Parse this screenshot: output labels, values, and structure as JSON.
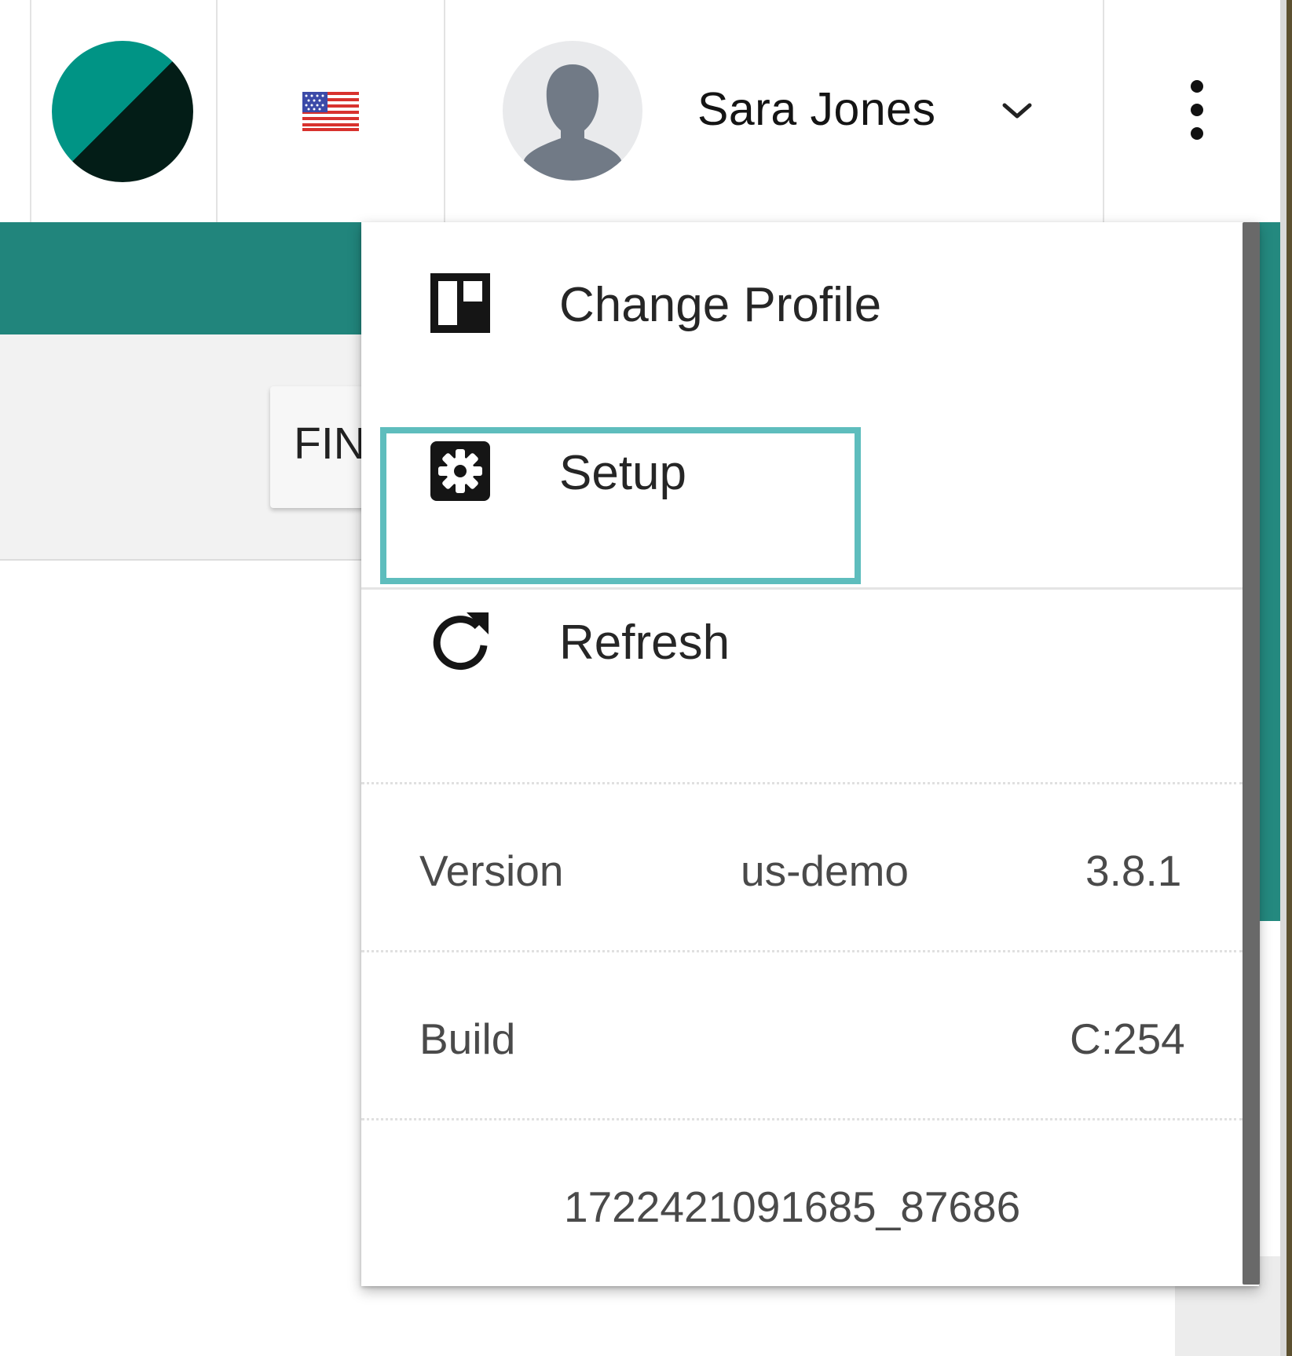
{
  "header": {
    "user_name": "Sara Jones",
    "icons": {
      "logo": "brand-logo",
      "flag": "us-flag-icon",
      "avatar": "user-avatar",
      "dropdown": "chevron-down-icon",
      "more": "more-vert-icon"
    }
  },
  "background": {
    "button_label": "FIN"
  },
  "menu": {
    "items": [
      {
        "label": "Change Profile",
        "icon": "dashboard-icon"
      },
      {
        "label": "Setup",
        "icon": "settings-icon"
      },
      {
        "label": "Refresh",
        "icon": "refresh-icon"
      }
    ],
    "version": {
      "label": "Version",
      "env": "us-demo",
      "number": "3.8.1"
    },
    "build": {
      "label": "Build",
      "value": "C:254"
    },
    "build_id": "1722421091685_87686"
  },
  "colors": {
    "brand_teal": "#009485",
    "band_teal": "#21857c",
    "highlight": "#5ebdbd"
  }
}
